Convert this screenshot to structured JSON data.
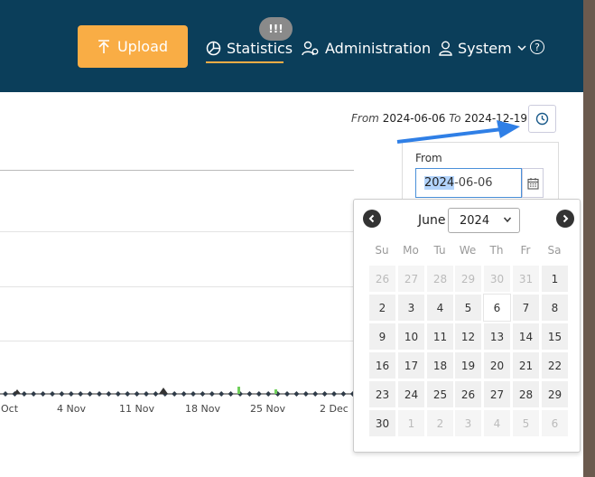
{
  "header": {
    "upload_label": "Upload",
    "badge": "!!!",
    "nav": {
      "statistics": "Statistics",
      "administration": "Administration",
      "system": "System",
      "help": "?"
    },
    "accent": "#f9ad45",
    "bg": "#0b3e5a"
  },
  "date_range": {
    "from_label": "From",
    "from_value": "2024-06-06",
    "to_label": "To",
    "to_value": "2024-12-19"
  },
  "picker": {
    "from_label": "From",
    "input_selected": "2024",
    "input_rest": "-06-06"
  },
  "calendar": {
    "month": "June",
    "year": "2024",
    "weekdays": [
      "Su",
      "Mo",
      "Tu",
      "We",
      "Th",
      "Fr",
      "Sa"
    ],
    "weeks": [
      [
        {
          "d": "26",
          "m": true
        },
        {
          "d": "27",
          "m": true
        },
        {
          "d": "28",
          "m": true
        },
        {
          "d": "29",
          "m": true
        },
        {
          "d": "30",
          "m": true
        },
        {
          "d": "31",
          "m": true
        },
        {
          "d": "1"
        }
      ],
      [
        {
          "d": "2"
        },
        {
          "d": "3"
        },
        {
          "d": "4"
        },
        {
          "d": "5"
        },
        {
          "d": "6",
          "t": true
        },
        {
          "d": "7"
        },
        {
          "d": "8"
        }
      ],
      [
        {
          "d": "9"
        },
        {
          "d": "10"
        },
        {
          "d": "11"
        },
        {
          "d": "12"
        },
        {
          "d": "13"
        },
        {
          "d": "14"
        },
        {
          "d": "15"
        }
      ],
      [
        {
          "d": "16"
        },
        {
          "d": "17"
        },
        {
          "d": "18"
        },
        {
          "d": "19"
        },
        {
          "d": "20"
        },
        {
          "d": "21"
        },
        {
          "d": "22"
        }
      ],
      [
        {
          "d": "23"
        },
        {
          "d": "24"
        },
        {
          "d": "25"
        },
        {
          "d": "26"
        },
        {
          "d": "27"
        },
        {
          "d": "28"
        },
        {
          "d": "29"
        }
      ],
      [
        {
          "d": "30"
        },
        {
          "d": "1",
          "m": true
        },
        {
          "d": "2",
          "m": true
        },
        {
          "d": "3",
          "m": true
        },
        {
          "d": "4",
          "m": true
        },
        {
          "d": "5",
          "m": true
        },
        {
          "d": "6",
          "m": true
        }
      ]
    ]
  },
  "chart": {
    "x_ticks": [
      "Oct",
      "4 Nov",
      "11 Nov",
      "18 Nov",
      "25 Nov",
      "2 Dec"
    ]
  },
  "annotation_color": "#2f7fe6"
}
